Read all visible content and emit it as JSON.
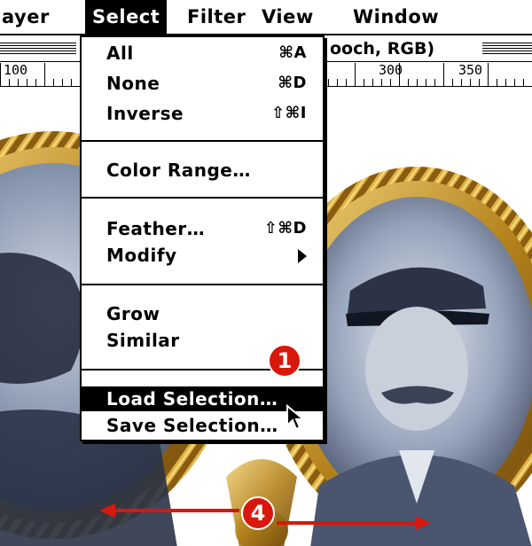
{
  "menubar": {
    "items": [
      "ayer",
      "Select",
      "Filter",
      "View",
      "Window"
    ],
    "active": "Select"
  },
  "window": {
    "title_fragment": "ooch, RGB)",
    "title_leading": "("
  },
  "ruler": {
    "labels": [
      "100",
      "300",
      "350"
    ]
  },
  "select_menu": {
    "all": {
      "label": "All",
      "shortcut": "⌘A"
    },
    "none": {
      "label": "None",
      "shortcut": "⌘D"
    },
    "inverse": {
      "label": "Inverse",
      "shortcut": "⇧⌘I"
    },
    "color_range": {
      "label": "Color Range…"
    },
    "feather": {
      "label": "Feather…",
      "shortcut": "⇧⌘D"
    },
    "modify": {
      "label": "Modify"
    },
    "grow": {
      "label": "Grow"
    },
    "similar": {
      "label": "Similar"
    },
    "load_selection": {
      "label": "Load Selection…"
    },
    "save_selection": {
      "label": "Save Selection…"
    }
  },
  "callouts": {
    "step1": "1",
    "step4": "4"
  },
  "colors": {
    "callout_red": "#d8180c",
    "gold": "#b8861e",
    "photo_tint": "#9aa8c2"
  }
}
